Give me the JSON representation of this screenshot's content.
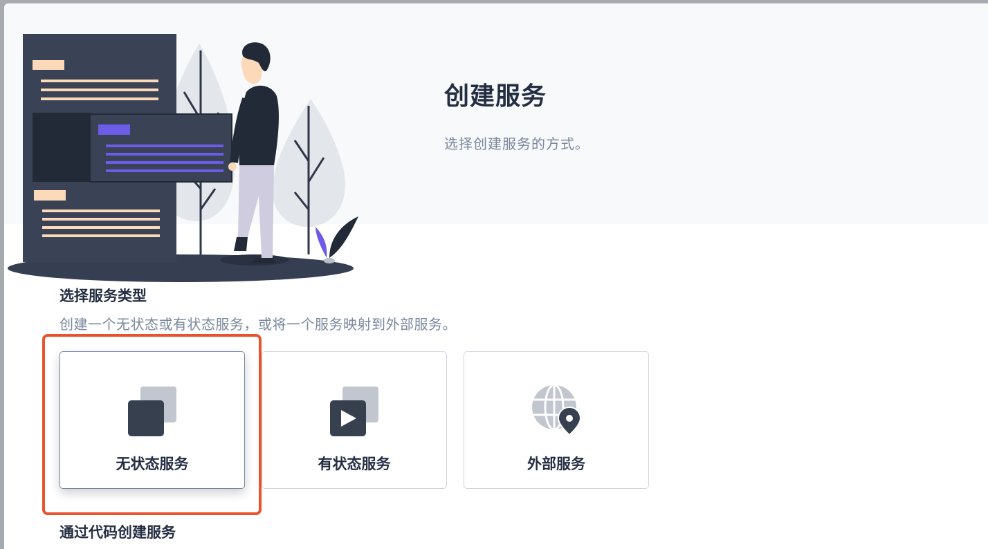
{
  "modal": {
    "title": "创建服务",
    "description": "选择创建服务的方式。"
  },
  "service_type": {
    "title": "选择服务类型",
    "description": "创建一个无状态或有状态服务，或将一个服务映射到外部服务。",
    "options": [
      {
        "label": "无状态服务",
        "icon": "stateless-service-icon",
        "selected": true
      },
      {
        "label": "有状态服务",
        "icon": "stateful-service-icon",
        "selected": false
      },
      {
        "label": "外部服务",
        "icon": "external-service-icon",
        "selected": false
      }
    ]
  },
  "code_section": {
    "title": "通过代码创建服务"
  },
  "colors": {
    "text_primary": "#242e42",
    "text_secondary": "#79879c",
    "highlight": "#e8522d",
    "accent_purple": "#6c5ce7",
    "accent_peach": "#fcd9b8"
  }
}
